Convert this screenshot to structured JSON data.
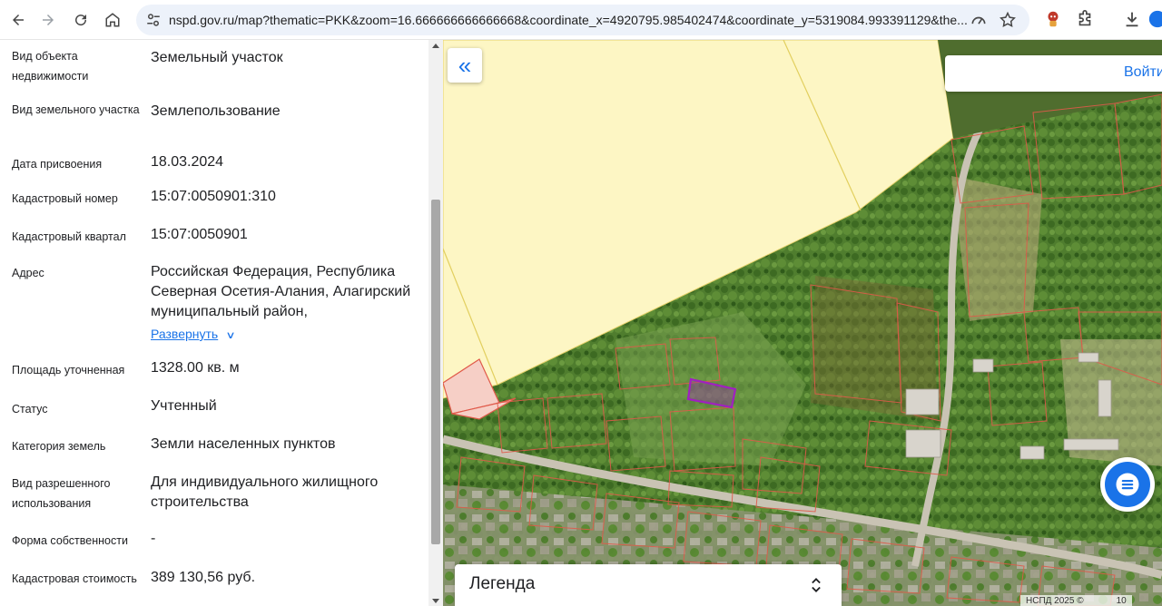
{
  "browser": {
    "url": "nspd.gov.ru/map?thematic=PKK&zoom=16.666666666666668&coordinate_x=4920795.985402474&coordinate_y=5319084.993391129&the..."
  },
  "panel": {
    "rows": [
      {
        "label": "Вид объекта недвижимости",
        "value": "Земельный участок"
      },
      {
        "label": "Вид земельного участка",
        "value": "Землепользование"
      },
      {
        "label": "Дата присвоения",
        "value": "18.03.2024"
      },
      {
        "label": "Кадастровый номер",
        "value": "15:07:0050901:310"
      },
      {
        "label": "Кадастровый квартал",
        "value": "15:07:0050901"
      },
      {
        "label": "Адрес",
        "value": "Российская Федерация, Республика Северная Осетия-Алания, Алагирский муниципальный район,"
      },
      {
        "label": "Площадь уточненная",
        "value": "1328.00 кв. м"
      },
      {
        "label": "Статус",
        "value": "Учтенный"
      },
      {
        "label": "Категория земель",
        "value": "Земли населенных пунктов"
      },
      {
        "label": "Вид разрешенного использования",
        "value": "Для индивидуального жилищного строительства"
      },
      {
        "label": "Форма собственности",
        "value": "-"
      },
      {
        "label": "Кадастровая стоимость",
        "value": "389 130,56 руб."
      }
    ],
    "expand_label": "Развернуть"
  },
  "map": {
    "login_label": "Войти",
    "legend_label": "Легенда",
    "copyright": "НСПД 2025 ©",
    "copyright_suffix": "10",
    "icons": {
      "collapse": "double-chevron-left-icon",
      "chat": "chat-bubble-icon",
      "legend_toggle": "unfold-icon"
    }
  },
  "colors": {
    "accent": "#1a73e8",
    "zone_fill": "#fdf6c4",
    "parcel_outline": "#e05a4a",
    "selected_parcel": "#a020c0"
  }
}
